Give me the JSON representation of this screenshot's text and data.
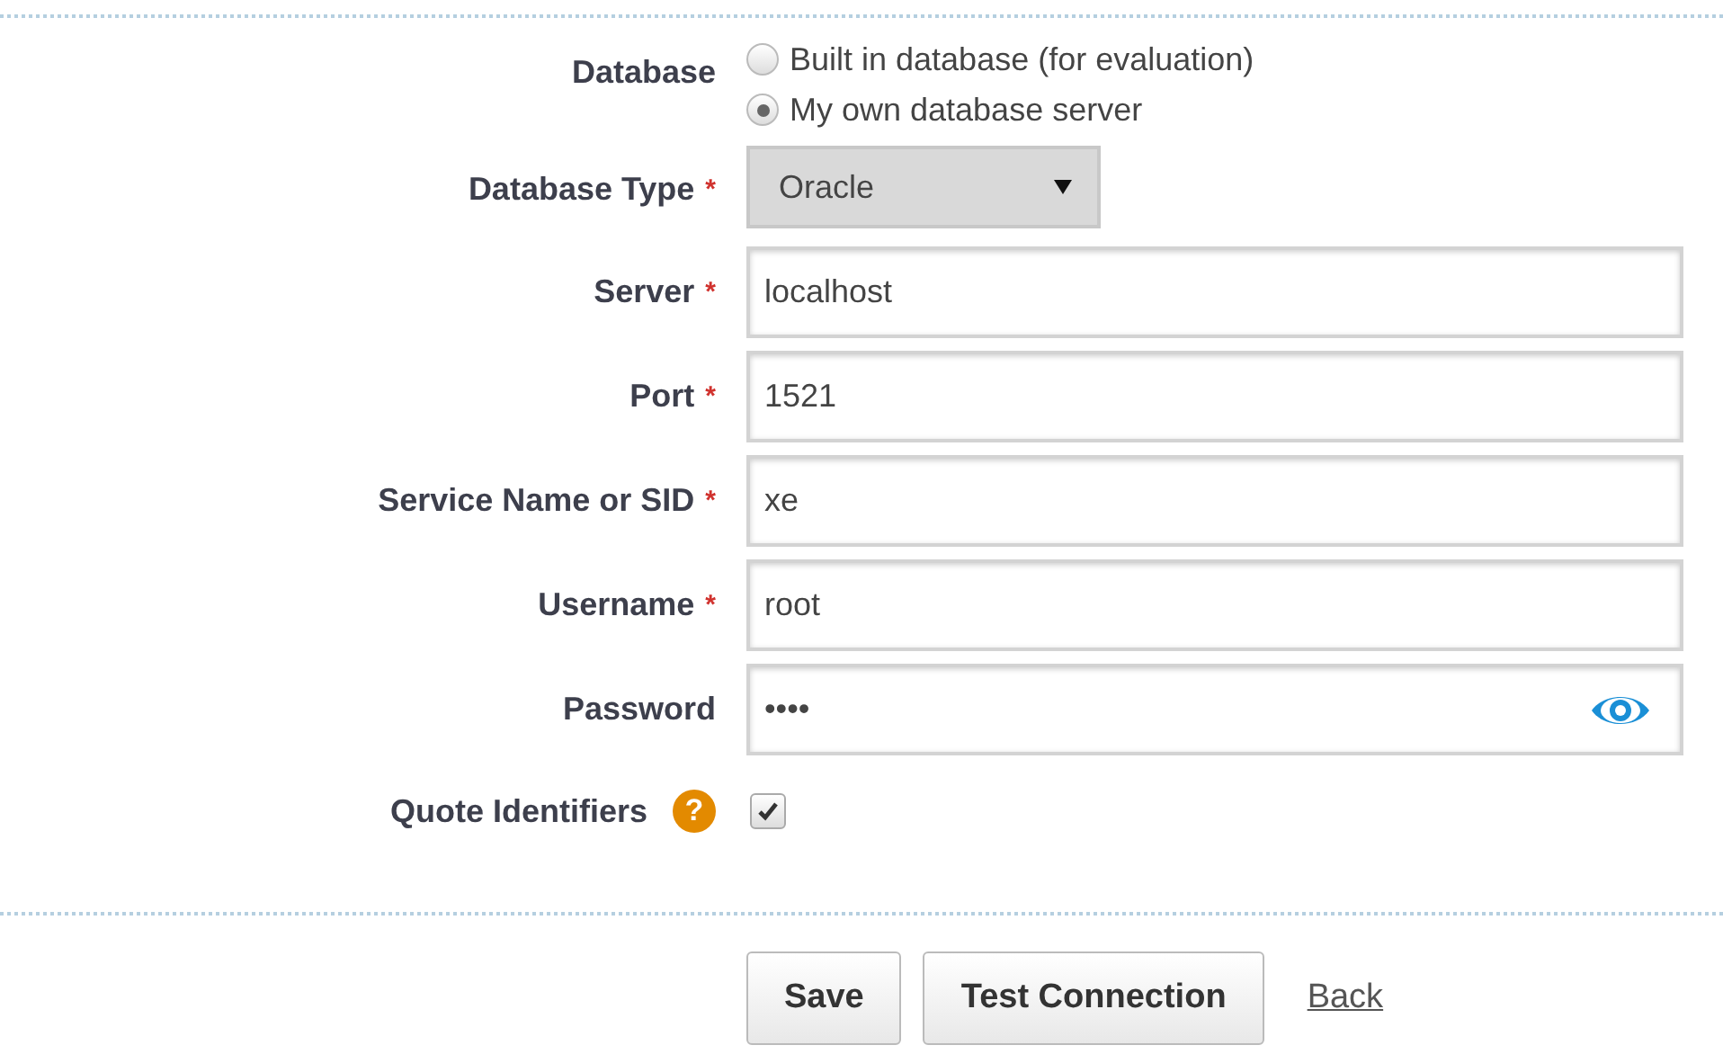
{
  "database": {
    "label": "Database",
    "options": [
      {
        "label": "Built in database (for evaluation)",
        "selected": false
      },
      {
        "label": "My own database server",
        "selected": true
      }
    ]
  },
  "fields": [
    {
      "kind": "select",
      "label": "Database Type",
      "required_mark": "*",
      "value": "Oracle"
    },
    {
      "kind": "text",
      "label": "Server",
      "required_mark": "*",
      "value": "localhost"
    },
    {
      "kind": "text",
      "label": "Port",
      "required_mark": "*",
      "value": "1521"
    },
    {
      "kind": "text",
      "label": "Service Name or SID",
      "required_mark": "*",
      "value": "xe"
    },
    {
      "kind": "text",
      "label": "Username",
      "required_mark": "*",
      "value": "root"
    },
    {
      "kind": "password",
      "label": "Password",
      "value": "••••"
    },
    {
      "kind": "checkbox",
      "label": "Quote Identifiers",
      "help": "?",
      "checked": true
    }
  ],
  "buttons": [
    "Save",
    "Test Connection"
  ],
  "link": "Back"
}
